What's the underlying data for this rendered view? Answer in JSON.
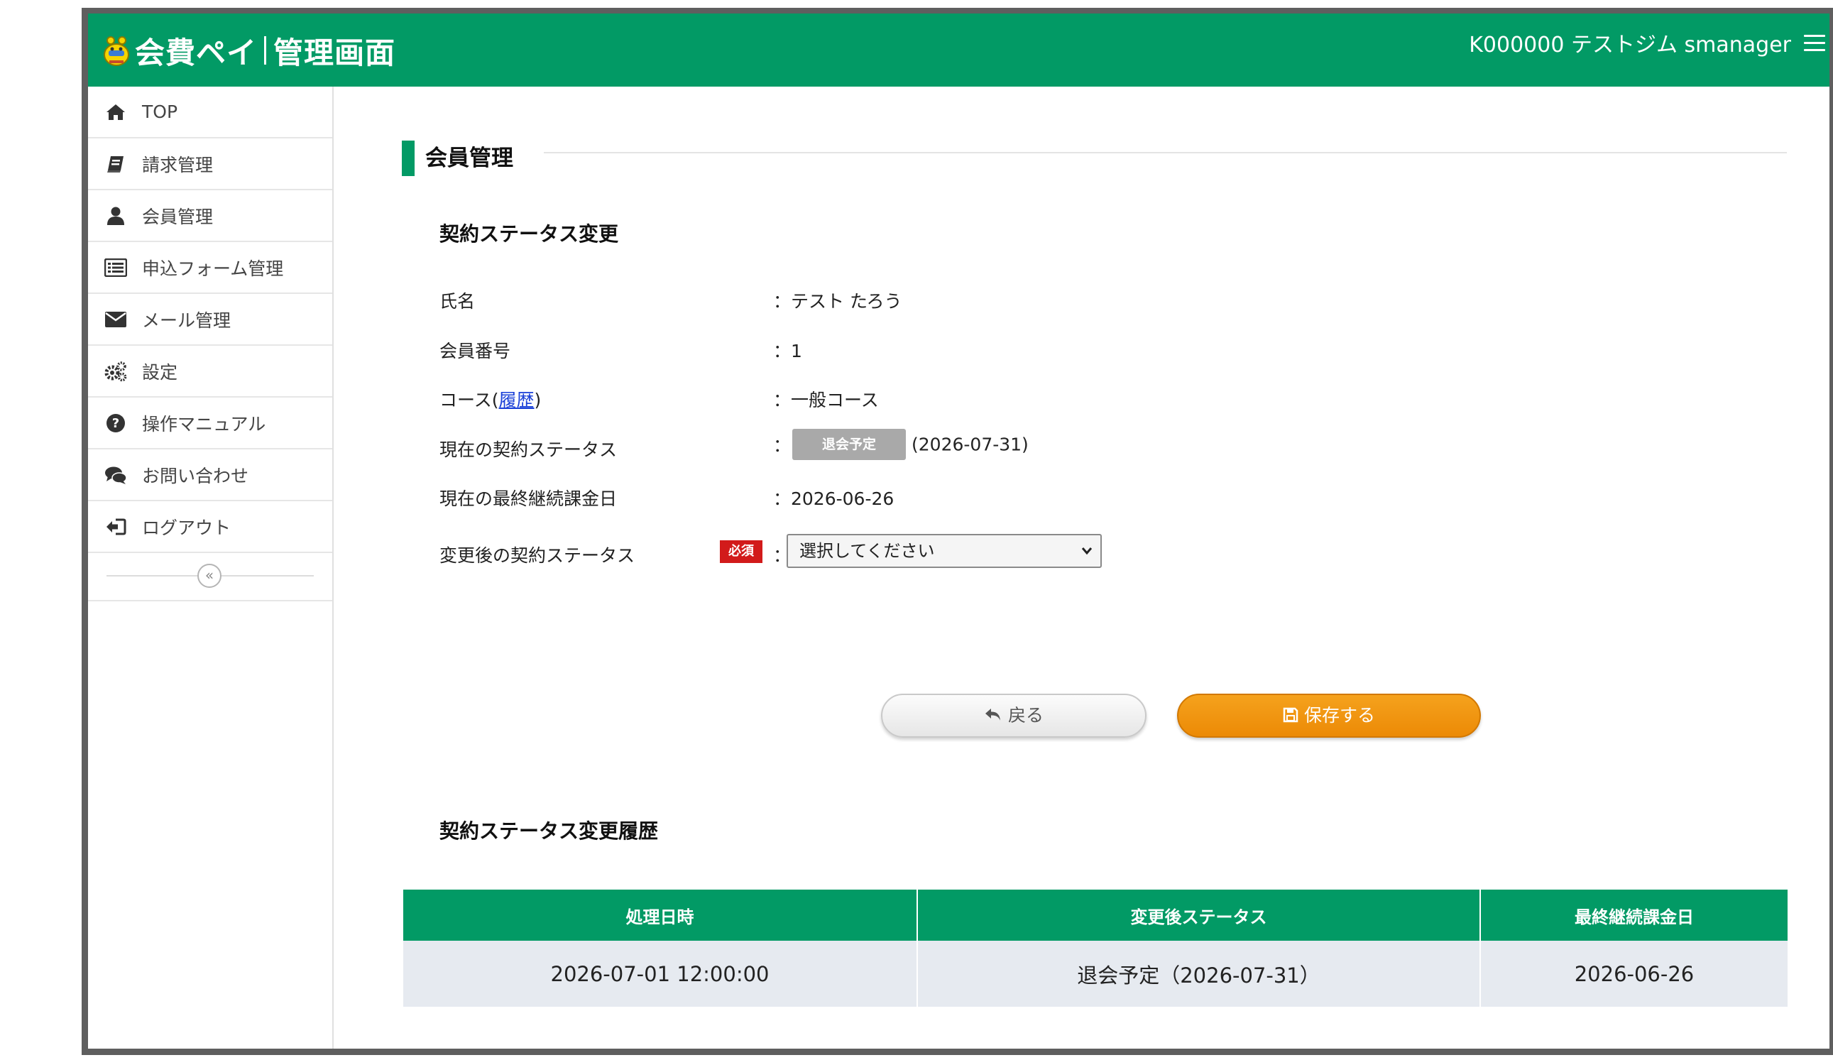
{
  "header": {
    "app_name": "会費ペイ",
    "app_section": "管理画面",
    "account": "K000000 テストジム smanager",
    "menu_icon": "hamburger-icon"
  },
  "colors": {
    "brand_green": "#029a65",
    "save_orange": "#ee8d0a",
    "required_red": "#d21b1b",
    "status_gray": "#a9a9a9"
  },
  "sidebar": {
    "items": [
      {
        "label": "TOP",
        "icon": "home-icon"
      },
      {
        "label": "請求管理",
        "icon": "book-icon"
      },
      {
        "label": "会員管理",
        "icon": "user-icon"
      },
      {
        "label": "申込フォーム管理",
        "icon": "list-form-icon"
      },
      {
        "label": "メール管理",
        "icon": "envelope-icon"
      },
      {
        "label": "設定",
        "icon": "gears-icon"
      },
      {
        "label": "操作マニュアル",
        "icon": "question-circle-icon"
      },
      {
        "label": "お問い合わせ",
        "icon": "chat-bubbles-icon"
      },
      {
        "label": "ログアウト",
        "icon": "sign-out-icon"
      }
    ],
    "collapse_symbol": "«"
  },
  "page": {
    "title": "会員管理",
    "form_title": "契約ステータス変更",
    "fields": {
      "name_label": "氏名",
      "name_value": "：テスト たろう",
      "member_no_label": "会員番号",
      "member_no_value": "：1",
      "course_label_prefix": "コース(",
      "course_history_link": "履歴",
      "course_label_suffix": ")",
      "course_value": "：一般コース",
      "current_status_label": "現在の契約ステータス",
      "current_status_colon": "：",
      "current_status_badge": "退会予定",
      "current_status_date": "(2026-07-31)",
      "last_billing_label": "現在の最終継続課金日",
      "last_billing_value": "：2026-06-26",
      "new_status_label": "変更後の契約ステータス",
      "required_badge": "必須",
      "new_status_colon": "：",
      "new_status_select": "選択してください"
    },
    "buttons": {
      "back": "戻る",
      "save": "保存する"
    },
    "history": {
      "title": "契約ステータス変更履歴",
      "headers": [
        "処理日時",
        "変更後ステータス",
        "最終継続課金日"
      ],
      "rows": [
        [
          "2026-07-01 12:00:00",
          "退会予定（2026-07-31）",
          "2026-06-26"
        ]
      ]
    }
  }
}
